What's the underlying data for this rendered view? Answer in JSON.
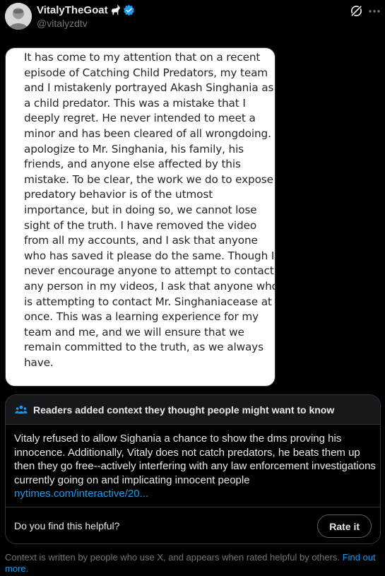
{
  "author": {
    "display_name": "VitalyTheGoat",
    "handle": "@vitalyzdtv"
  },
  "icons": {
    "goat": "goat-emoji-icon",
    "verified": "verified-badge-icon",
    "grok": "grok-icon",
    "more": "more-options-icon",
    "people": "people-icon"
  },
  "colors": {
    "background": "#000000",
    "text": "#e7e9ea",
    "secondary_text": "#71767b",
    "accent": "#1d9bf0",
    "border": "#2f3336",
    "note_header_bg": "#16181c"
  },
  "statement_lines": [
    "It has come to my attention that on a recent",
    "episode of Catching Child Predators, my team",
    "and I mistakenly portrayed Akash Singhania as",
    "a child predator. This was a mistake that I",
    "deeply regret. He never intended to meet a",
    "minor and has been cleared of all wrongdoing. I",
    "apologize to Mr. Singhania, his family, his",
    "friends, and anyone else affected by this",
    "mistake. To be clear, the work we do to expose",
    "predatory behavior is of the utmost",
    "importance, but in doing so, we cannot lose",
    "sight of the truth. I have removed the video",
    "from all my accounts, and I ask that anyone",
    "who has saved it please do the same. Though I",
    "never encourage anyone to attempt to contact",
    "any person in my videos, I ask that anyone who",
    "is attempting to contact Mr. Singhaniacease at",
    "once. This was a learning experience for my",
    "team and me, and we will ensure that we",
    "remain committed to the truth, as we always",
    "have."
  ],
  "community_note": {
    "title": "Readers added context they thought people might want to know",
    "body": "Vitaly refused to allow Sighania a chance to show the dms proving his innocence. Additionally, Vitaly does not catch predators, he beats them up then they go free--actively interfering with any law enforcement investigations currently going on and implicating innocent people",
    "link_text": "nytimes.com/interactive/20...",
    "helpful_question": "Do you find this helpful?",
    "rate_button": "Rate it"
  },
  "footer": {
    "text": "Context is written by people who use X, and appears when rated helpful by others.",
    "link": "Find out more."
  }
}
